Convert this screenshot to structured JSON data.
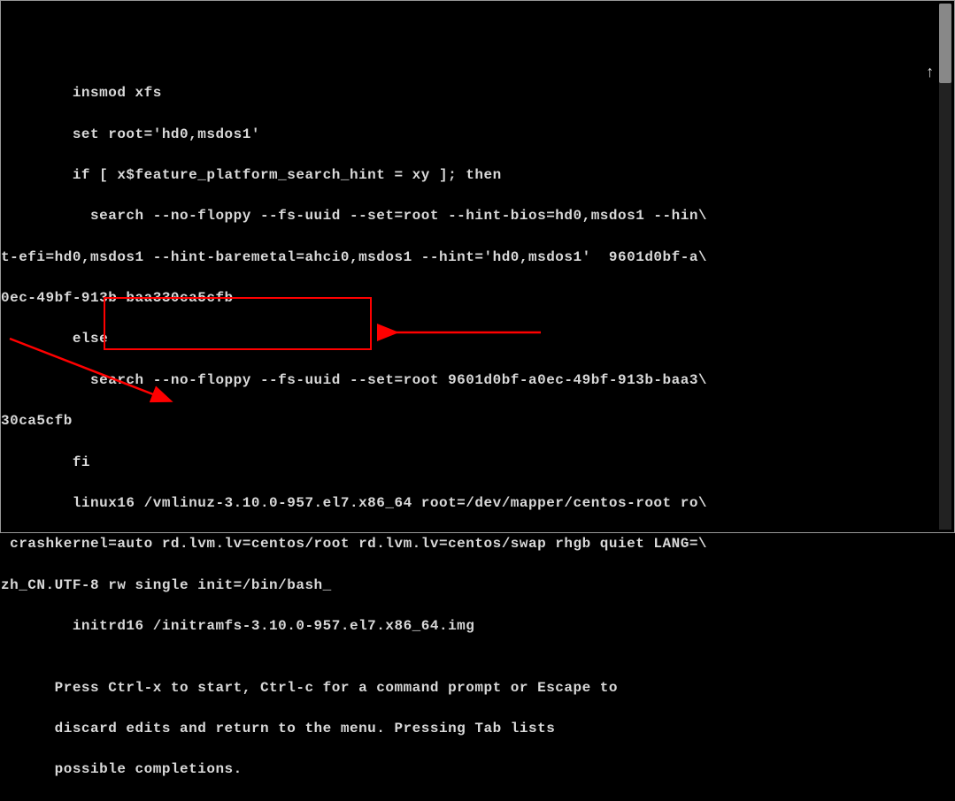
{
  "terminal": {
    "lines": [
      "        insmod xfs",
      "        set root='hd0,msdos1'",
      "        if [ x$feature_platform_search_hint = xy ]; then",
      "          search --no-floppy --fs-uuid --set=root --hint-bios=hd0,msdos1 --hin\\",
      "t-efi=hd0,msdos1 --hint-baremetal=ahci0,msdos1 --hint='hd0,msdos1'  9601d0bf-a\\",
      "0ec-49bf-913b-baa330ca5cfb",
      "        else",
      "          search --no-floppy --fs-uuid --set=root 9601d0bf-a0ec-49bf-913b-baa3\\",
      "30ca5cfb",
      "        fi",
      "        linux16 /vmlinuz-3.10.0-957.el7.x86_64 root=/dev/mapper/centos-root ro\\",
      " crashkernel=auto rd.lvm.lv=centos/root rd.lvm.lv=centos/swap rhgb quiet LANG=\\",
      "zh_CN.UTF-8 rw single init=/bin/bash_",
      "        initrd16 /initramfs-3.10.0-957.el7.x86_64.img",
      "",
      "      Press Ctrl-x to start, Ctrl-c for a command prompt or Escape to",
      "      discard edits and return to the menu. Pressing Tab lists",
      "      possible completions."
    ]
  },
  "annotation": {
    "highlighted_text": "rw single init=/bin/bash",
    "arrow_color": "#ff0000"
  },
  "indicators": {
    "up_arrow": "↑"
  }
}
